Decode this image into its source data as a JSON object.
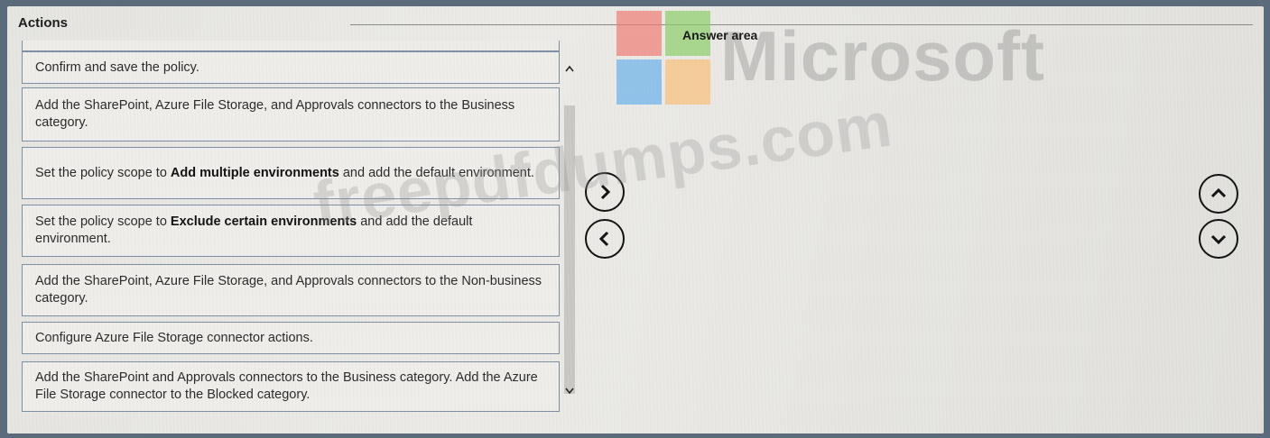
{
  "actions": {
    "title": "Actions",
    "items": [
      {
        "pre": "Confirm and save the policy.",
        "bold": "",
        "post": ""
      },
      {
        "pre": "Add the SharePoint, Azure File Storage, and Approvals connectors to the Business category.",
        "bold": "",
        "post": ""
      },
      {
        "pre": "Set the policy scope to ",
        "bold": "Add multiple environments",
        "post": " and add the default environment."
      },
      {
        "pre": "Set the policy scope to ",
        "bold": "Exclude certain environments",
        "post": " and add the default environment."
      },
      {
        "pre": "Add the SharePoint, Azure File Storage, and Approvals connectors to the Non-business category.",
        "bold": "",
        "post": ""
      },
      {
        "pre": "Configure Azure File Storage connector actions.",
        "bold": "",
        "post": ""
      },
      {
        "pre": "Add the SharePoint and Approvals connectors to the Business category. Add the Azure File Storage connector to the Blocked category.",
        "bold": "",
        "post": ""
      }
    ]
  },
  "answer_area": {
    "title": "Answer area"
  },
  "watermarks": {
    "brand": "Microsoft",
    "site": "freepdfdumps.com"
  },
  "icons": {
    "move_right": "chevron-right-icon",
    "move_left": "chevron-left-icon",
    "move_up": "chevron-up-icon",
    "move_down": "chevron-down-icon",
    "scroll_up": "caret-up-icon",
    "scroll_down": "caret-down-icon"
  },
  "colors": {
    "item_border": "#7d8fa3",
    "item_bg": "#efeeea",
    "panel_bg": "#e8e7e3",
    "outer_bg": "#5b6b7b",
    "logo_red": "#f0807a",
    "logo_green": "#8fcf6e",
    "logo_blue": "#6fb3ea",
    "logo_yellow": "#f9c27e"
  }
}
